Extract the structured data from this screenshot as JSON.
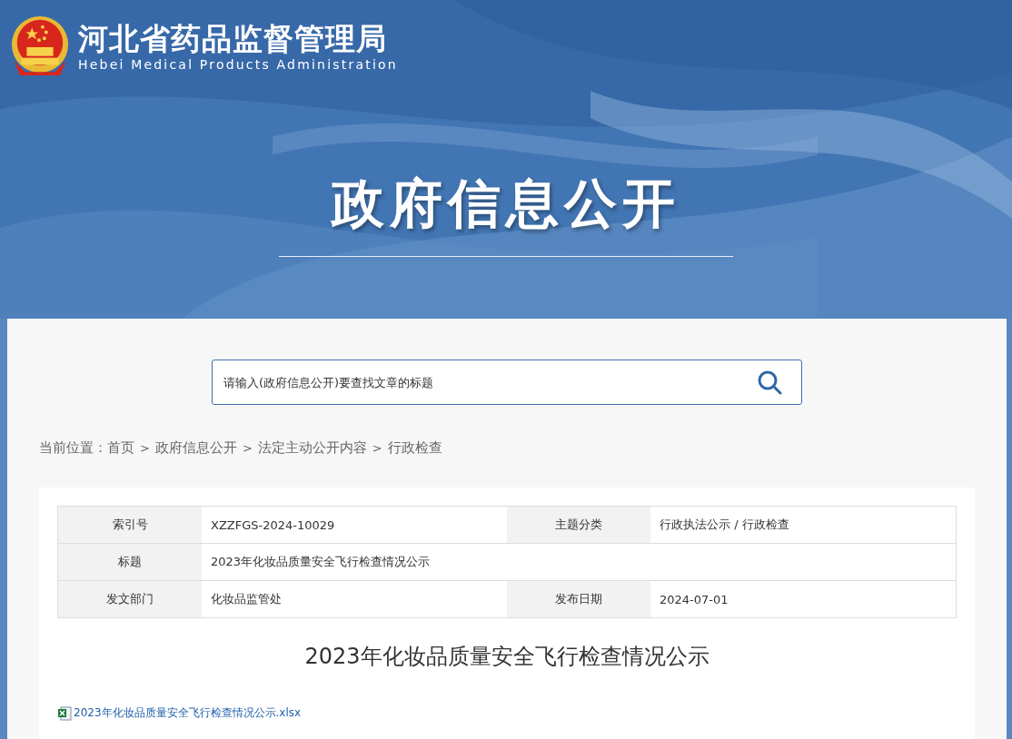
{
  "header": {
    "title": "河北省药品监督管理局",
    "subtitle": "Hebei Medical Products Administration",
    "banner_title": "政府信息公开"
  },
  "search": {
    "placeholder": "请输入(政府信息公开)要查找文章的标题"
  },
  "breadcrumb": {
    "label": "当前位置：",
    "items": [
      {
        "text": "首页"
      },
      {
        "separator": ">",
        "text": "政府信息公开"
      },
      {
        "separator": ">",
        "text": "法定主动公开内容"
      },
      {
        "separator": ">",
        "text": "行政检查"
      }
    ]
  },
  "info_table": {
    "rows": [
      {
        "cells": [
          {
            "kind": "label",
            "text": "索引号"
          },
          {
            "kind": "value",
            "text": "XZZFGS-2024-10029"
          },
          {
            "kind": "label",
            "text": "主题分类"
          },
          {
            "kind": "value",
            "text": "行政执法公示 / 行政检查"
          }
        ]
      },
      {
        "cells": [
          {
            "kind": "label",
            "text": "标题"
          },
          {
            "kind": "wide",
            "text": "2023年化妆品质量安全飞行检查情况公示"
          }
        ]
      },
      {
        "cells": [
          {
            "kind": "label",
            "text": "发文部门"
          },
          {
            "kind": "value",
            "text": "化妆品监管处"
          },
          {
            "kind": "label",
            "text": "发布日期"
          },
          {
            "kind": "value",
            "text": "2024-07-01"
          }
        ]
      }
    ]
  },
  "article": {
    "title": "2023年化妆品质量安全飞行检查情况公示",
    "attachments": [
      {
        "name": "2023年化妆品质量安全飞行检查情况公示.xlsx"
      }
    ]
  }
}
